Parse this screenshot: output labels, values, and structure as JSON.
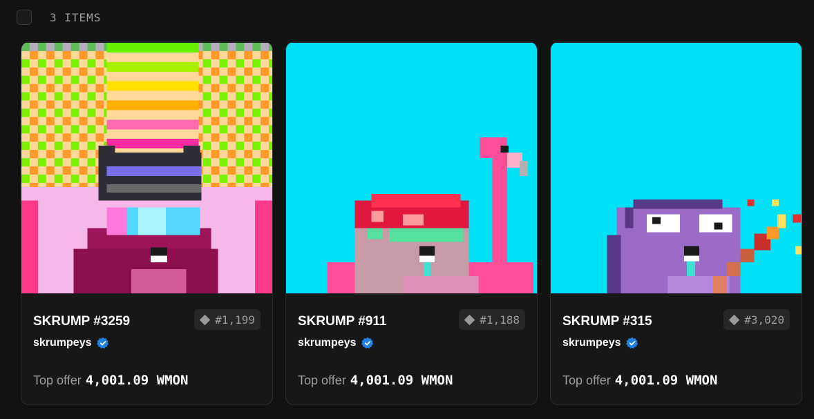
{
  "header": {
    "count_label": "3 ITEMS"
  },
  "colors": {
    "background": "#121212",
    "card": "#171717",
    "badge": "#2081e2",
    "art_cyan": "#00e1f5"
  },
  "items": [
    {
      "name": "SKRUMP #3259",
      "rank": "#1,199",
      "collection": "skrumpeys",
      "offer_label": "Top offer",
      "offer_value": "4,001.09 WMON"
    },
    {
      "name": "SKRUMP #911",
      "rank": "#1,188",
      "collection": "skrumpeys",
      "offer_label": "Top offer",
      "offer_value": "4,001.09 WMON"
    },
    {
      "name": "SKRUMP #315",
      "rank": "#3,020",
      "collection": "skrumpeys",
      "offer_label": "Top offer",
      "offer_value": "4,001.09 WMON"
    }
  ]
}
